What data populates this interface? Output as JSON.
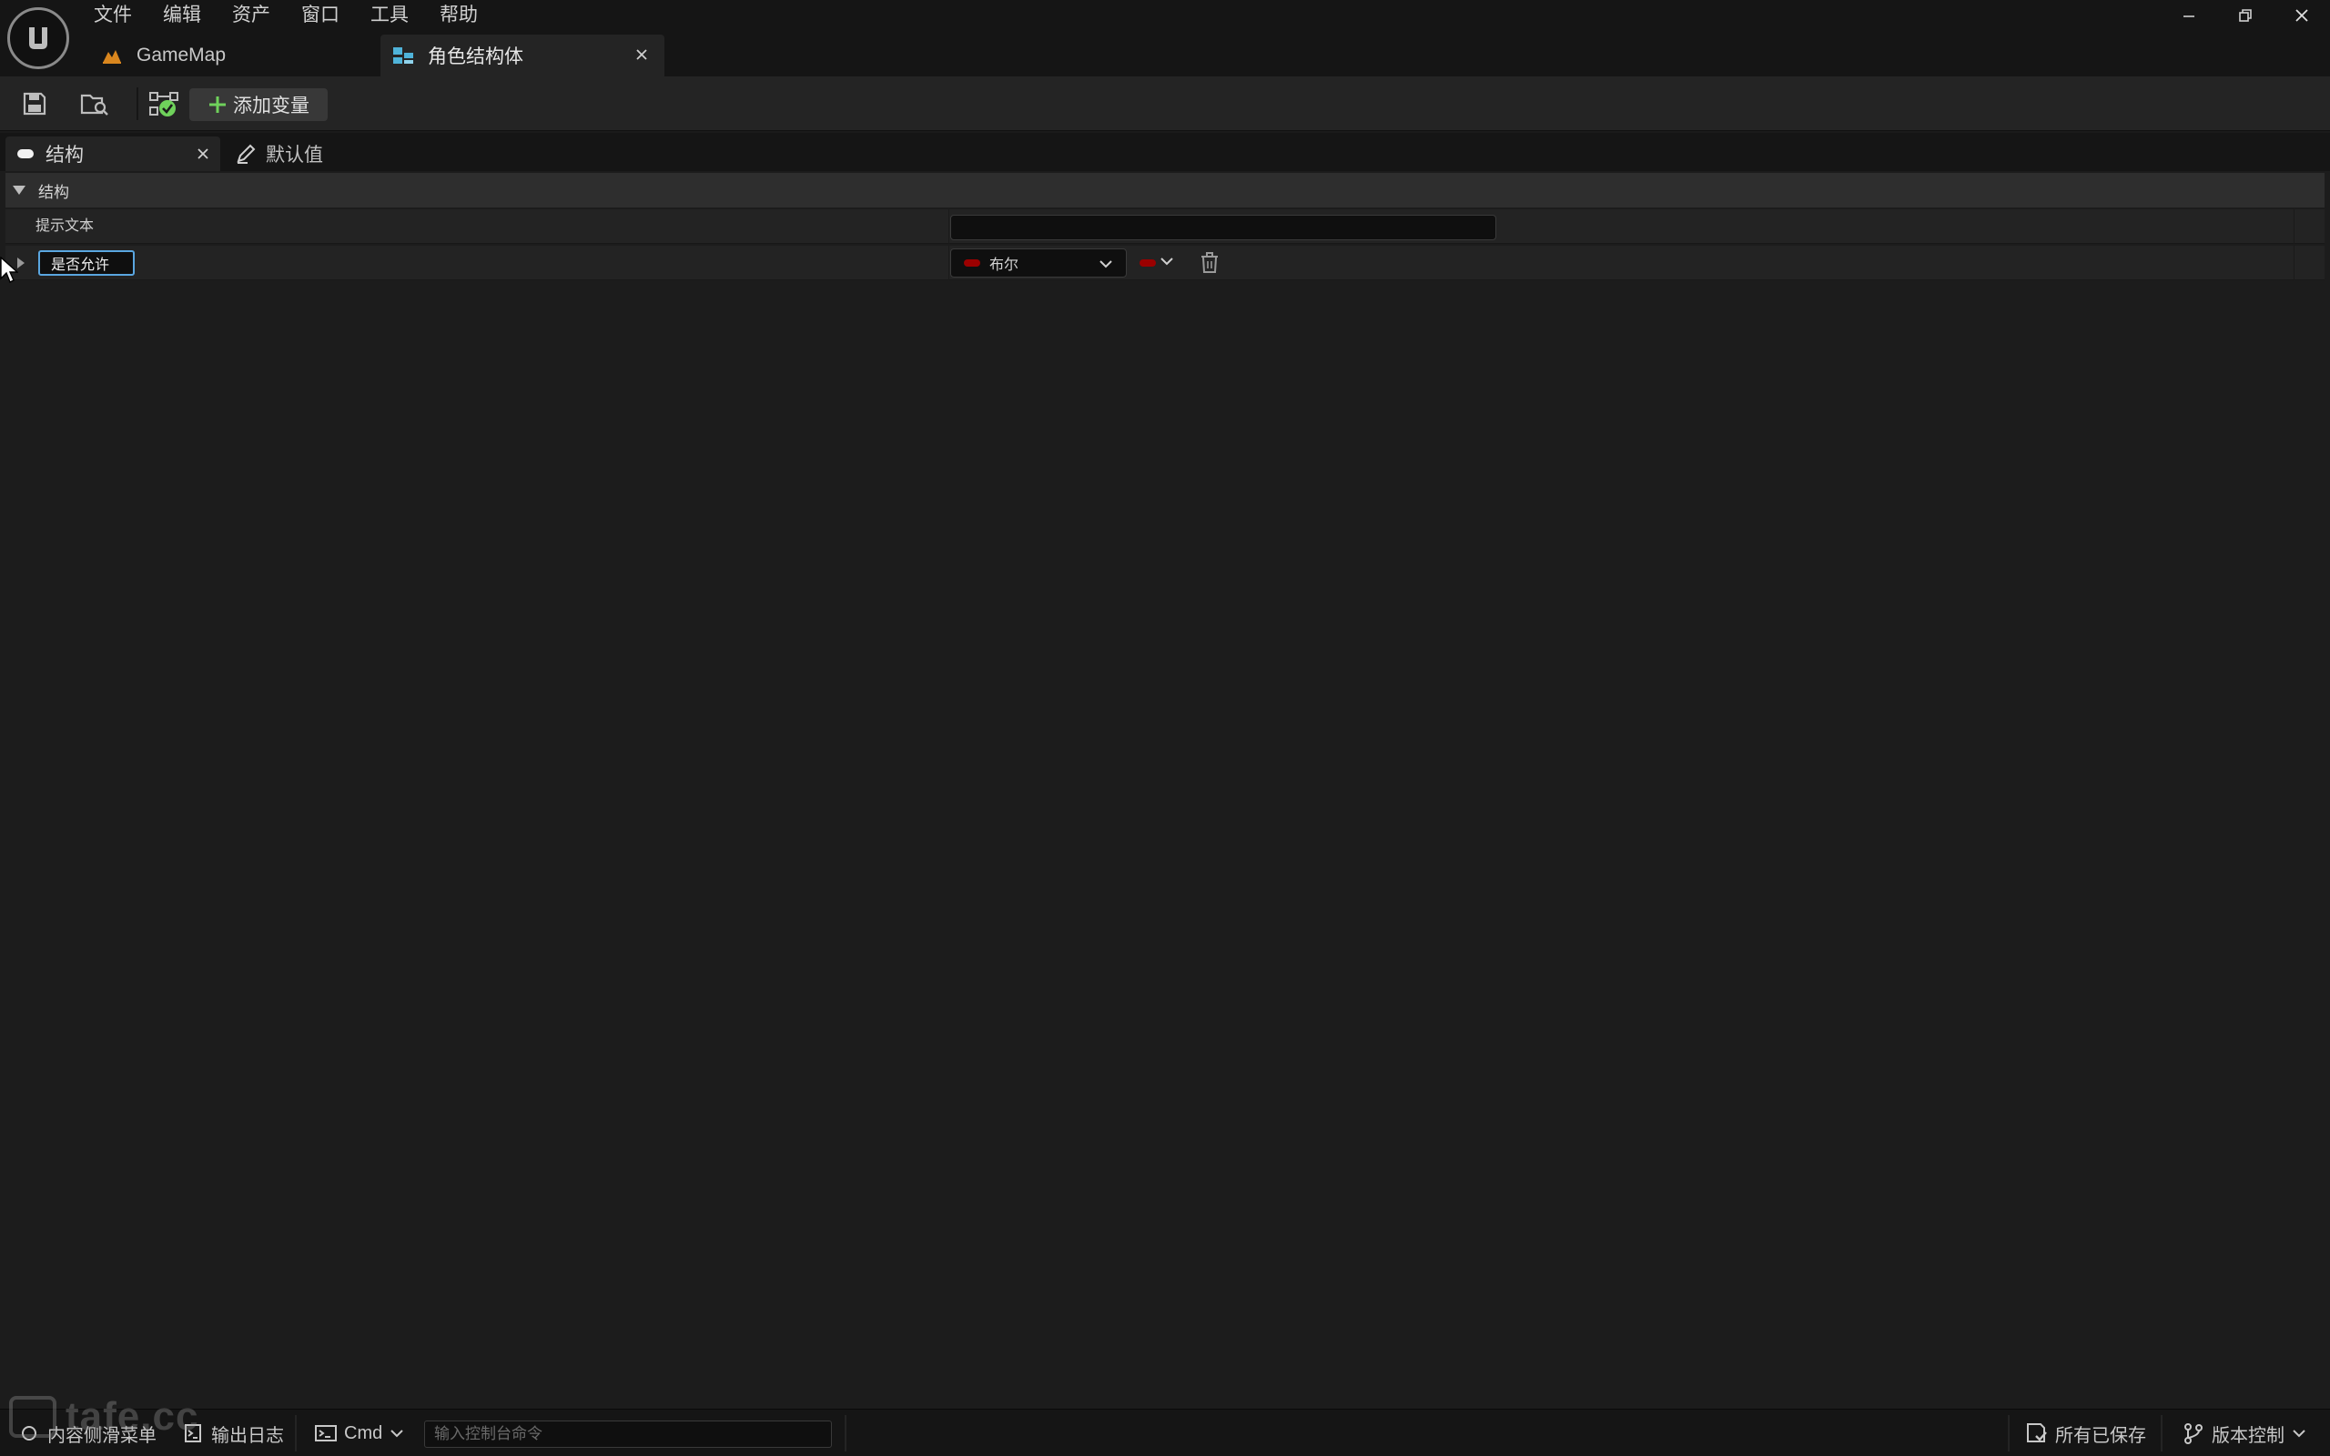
{
  "menu": {
    "items": [
      "文件",
      "编辑",
      "资产",
      "窗口",
      "工具",
      "帮助"
    ]
  },
  "window_controls": {
    "icons": [
      "minimize-icon",
      "restore-icon",
      "close-icon"
    ]
  },
  "document_tabs": [
    {
      "label": "GameMap",
      "icon": "level-map-icon",
      "active": false
    },
    {
      "label": "角色结构体",
      "icon": "struct-asset-icon",
      "active": true
    }
  ],
  "toolbar": {
    "add_variable_label": "添加变量",
    "icons": [
      "save-icon",
      "browse-icon",
      "check-status-icon",
      "plus-icon"
    ]
  },
  "panel_tabs": [
    {
      "label": "结构",
      "icon": "struct-pill-icon",
      "active": true
    },
    {
      "label": "默认值",
      "icon": "pencil-icon",
      "active": false
    }
  ],
  "structure": {
    "category_label": "结构",
    "tooltip_label": "提示文本",
    "tooltip_value": "",
    "member": {
      "name": "是否允许",
      "type_label": "布尔",
      "type_color": "#9b0000"
    }
  },
  "statusbar": {
    "content_drawer": "内容侧滑菜单",
    "output_log": "输出日志",
    "cmd_label": "Cmd",
    "console_placeholder": "输入控制台命令",
    "all_saved": "所有已保存",
    "source_control": "版本控制"
  },
  "watermark": {
    "text": "tafe.cc"
  },
  "colors": {
    "accent_blue": "#5aa6e0",
    "bool_red": "#9b0000",
    "add_green": "#6fd15b"
  }
}
